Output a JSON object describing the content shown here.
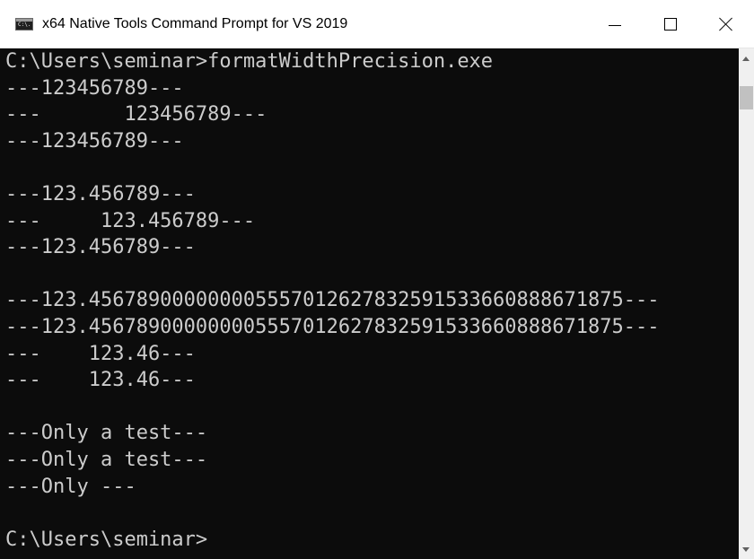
{
  "window": {
    "title": "x64 Native Tools Command Prompt for VS 2019",
    "icon_label": "C:\\."
  },
  "console": {
    "lines": [
      "C:\\Users\\seminar>formatWidthPrecision.exe",
      "---123456789---",
      "---       123456789---",
      "---123456789---",
      "",
      "---123.456789---",
      "---     123.456789---",
      "---123.456789---",
      "",
      "---123.456789000000005557012627832591533660888671875---",
      "---123.456789000000005557012627832591533660888671875---",
      "---    123.46---",
      "---    123.46---",
      "",
      "---Only a test---",
      "---Only a test---",
      "---Only ---",
      "",
      "C:\\Users\\seminar>"
    ]
  },
  "colors": {
    "console_background": "#0c0c0c",
    "console_text": "#cccccc",
    "titlebar_background": "#ffffff",
    "scrollbar_track": "#f0f0f0",
    "scrollbar_thumb": "#c1c1c1"
  },
  "icons": {
    "app": "cmd-icon",
    "minimize": "minimize-icon",
    "maximize": "maximize-icon",
    "close": "close-icon",
    "scroll_up": "arrow-up-icon",
    "scroll_down": "arrow-down-icon"
  }
}
